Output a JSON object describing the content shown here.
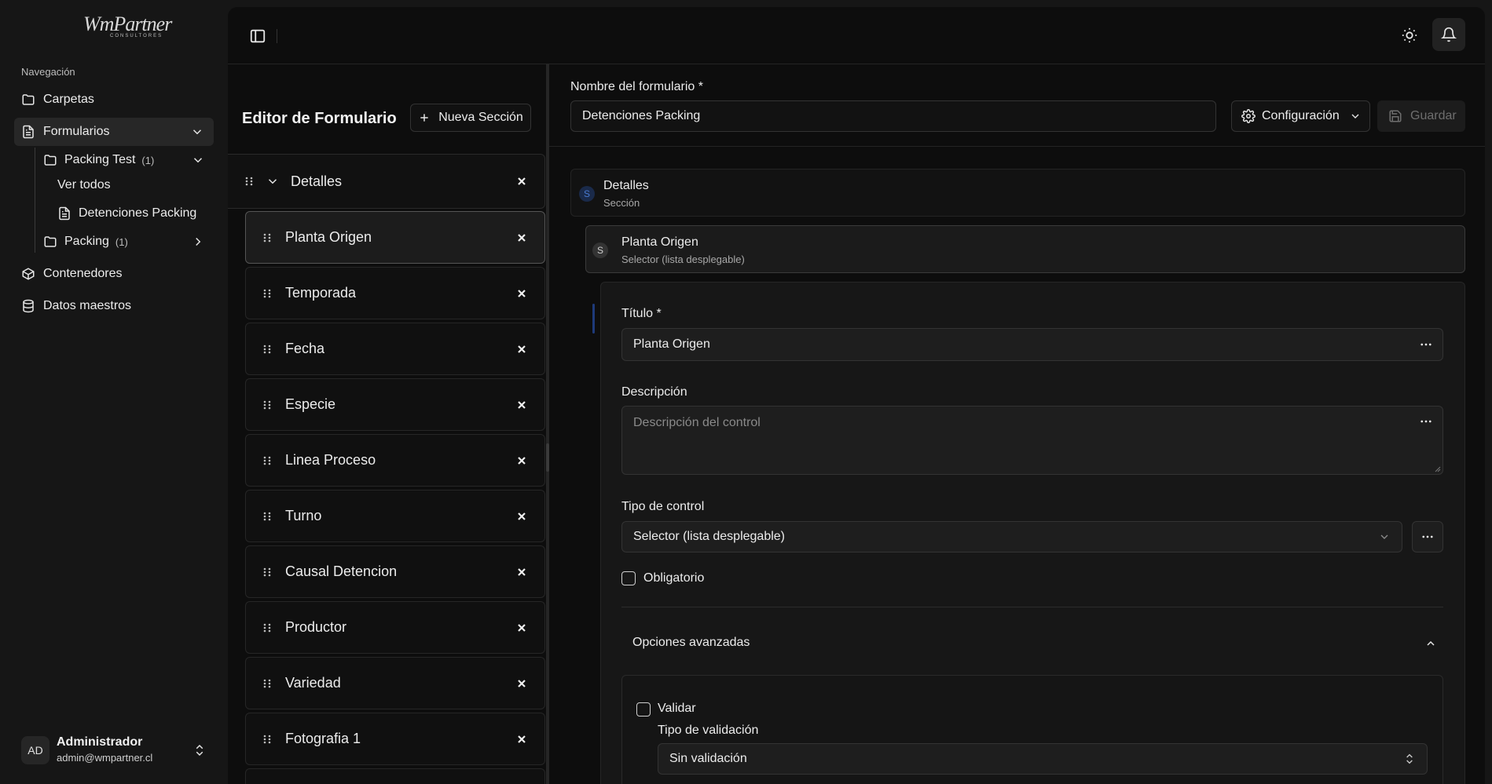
{
  "sidebar": {
    "logo_main": "WmPartner",
    "logo_sub": "CONSULTORES",
    "nav_title": "Navegación",
    "items": {
      "carpetas": "Carpetas",
      "formularios": "Formularios",
      "contenedores": "Contenedores",
      "datos_maestros": "Datos maestros"
    },
    "sub": {
      "packing_test": "Packing Test",
      "packing_test_count": "(1)",
      "ver_todos": "Ver todos",
      "detenciones_packing": "Detenciones Packing",
      "packing": "Packing",
      "packing_count": "(1)"
    },
    "user": {
      "initials": "AD",
      "name": "Administrador",
      "email": "admin@wmpartner.cl"
    }
  },
  "editor": {
    "title": "Editor de Formulario",
    "new_section": "Nueva Sección",
    "section_label": "Detalles",
    "fields": [
      "Planta Origen",
      "Temporada",
      "Fecha",
      "Especie",
      "Linea Proceso",
      "Turno",
      "Causal Detencion",
      "Productor",
      "Variedad",
      "Fotografia 1"
    ]
  },
  "form": {
    "name_label": "Nombre del formulario *",
    "name_value": "Detenciones Packing",
    "config_label": "Configuración",
    "save_label": "Guardar"
  },
  "tree": {
    "section": {
      "badge": "S",
      "title": "Detalles",
      "subtitle": "Sección"
    },
    "field": {
      "badge": "S",
      "title": "Planta Origen",
      "subtitle": "Selector (lista desplegable)"
    }
  },
  "props": {
    "title_label": "Título *",
    "title_value": "Planta Origen",
    "desc_label": "Descripción",
    "desc_placeholder": "Descripción del control",
    "type_label": "Tipo de control",
    "type_value": "Selector (lista desplegable)",
    "required_label": "Obligatorio",
    "advanced_label": "Opciones avanzadas",
    "validate_label": "Validar",
    "validation_type_label": "Tipo de validación",
    "validation_type_value": "Sin validación"
  }
}
